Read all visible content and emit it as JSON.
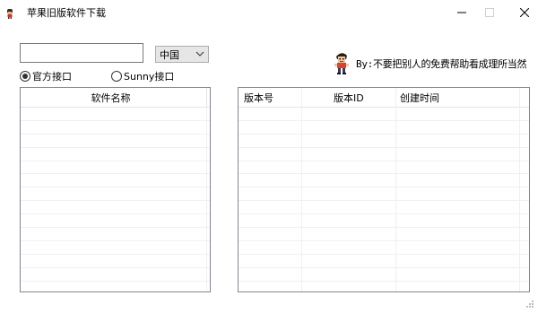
{
  "window": {
    "title": "苹果旧版软件下载"
  },
  "search": {
    "value": "",
    "placeholder": ""
  },
  "country_select": {
    "selected": "中国"
  },
  "author": {
    "label": "By:不要把别人的免费帮助看成理所当然"
  },
  "radios": [
    {
      "label": "官方接口",
      "checked": true
    },
    {
      "label": "Sunny接口",
      "checked": false
    }
  ],
  "left_list": {
    "header": "软件名称",
    "items": []
  },
  "right_table": {
    "columns": [
      "版本号",
      "版本ID",
      "创建时间"
    ],
    "rows": []
  }
}
